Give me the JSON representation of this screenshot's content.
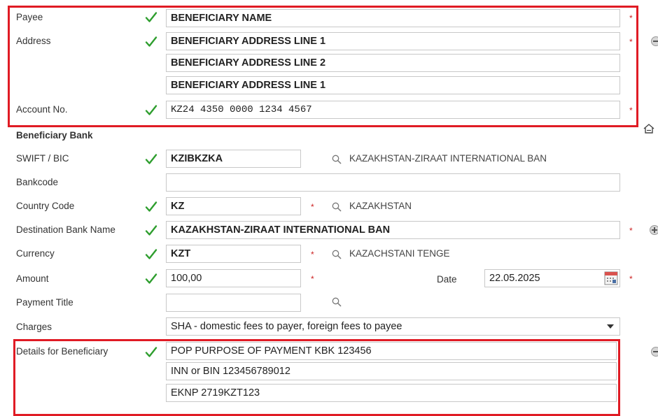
{
  "colors": {
    "check": "#2e9e2e",
    "required": "#cc2222",
    "highlight": "#e01b24"
  },
  "payee": {
    "label": "Payee",
    "value": "BENEFICIARY NAME"
  },
  "address": {
    "label": "Address",
    "line1": "BENEFICIARY ADDRESS LINE 1",
    "line2": "BENEFICIARY ADDRESS LINE 2",
    "line3": "BENEFICIARY ADDRESS LINE 1"
  },
  "account": {
    "label": "Account No.",
    "value": "KZ24 4350 0000 1234 4567"
  },
  "beneficiary_bank": {
    "label": "Beneficiary Bank"
  },
  "swift": {
    "label": "SWIFT / BIC",
    "value": "KZIBKZKA",
    "lookup": "KAZAKHSTAN-ZIRAAT INTERNATIONAL BAN"
  },
  "bankcode": {
    "label": "Bankcode",
    "value": ""
  },
  "country": {
    "label": "Country Code",
    "value": "KZ",
    "lookup": "KAZAKHSTAN"
  },
  "dest_bank": {
    "label": "Destination Bank Name",
    "value": "KAZAKHSTAN-ZIRAAT INTERNATIONAL BAN"
  },
  "currency": {
    "label": "Currency",
    "value": "KZT",
    "lookup": "KAZACHSTANI TENGE"
  },
  "amount": {
    "label": "Amount",
    "value": "100,00"
  },
  "date": {
    "label": "Date",
    "value": "22.05.2025"
  },
  "payment_title": {
    "label": "Payment Title",
    "value": ""
  },
  "charges": {
    "label": "Charges",
    "value": "SHA - domestic fees to payer, foreign fees to payee"
  },
  "details": {
    "label": "Details for Beneficiary",
    "line1": "POP PURPOSE OF PAYMENT KBK 123456",
    "line2": "INN or BIN 123456789012",
    "line3": "EKNP 2719KZT123"
  },
  "icons": {
    "check": "check-icon",
    "search": "search-icon",
    "collapse": "minus-circle-icon",
    "expand": "plus-circle-icon",
    "home": "home-icon",
    "calendar": "calendar-icon"
  }
}
